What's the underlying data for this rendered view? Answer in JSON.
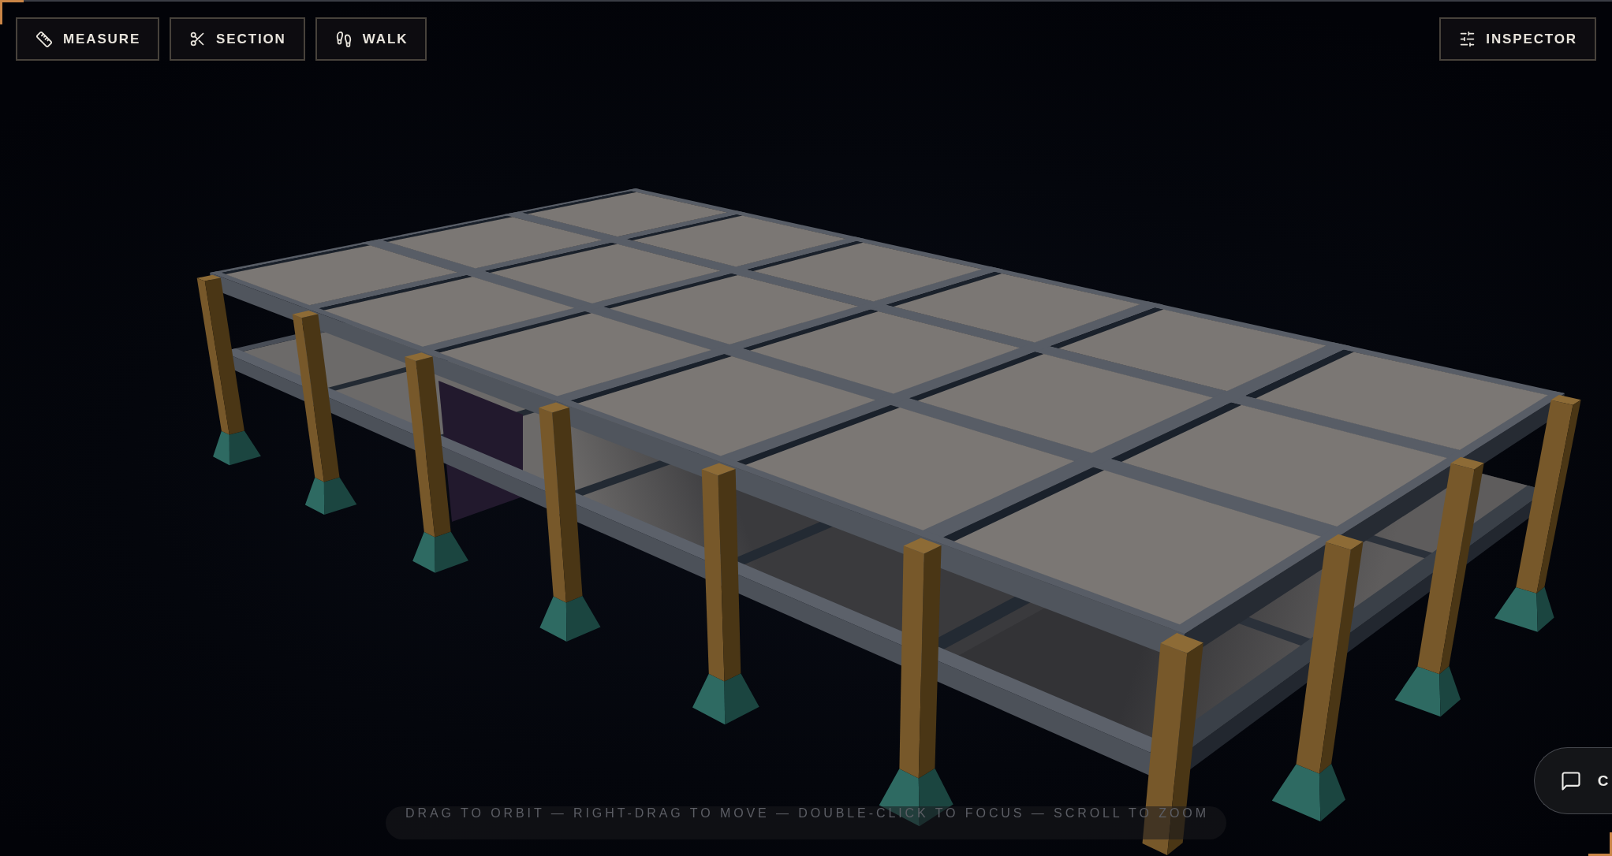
{
  "toolbar": {
    "tools": [
      {
        "kind": "measure",
        "label": "MEASURE"
      },
      {
        "kind": "section",
        "label": "SECTION"
      },
      {
        "kind": "walk",
        "label": "WALK"
      }
    ]
  },
  "inspector_button": {
    "label": "INSPECTOR"
  },
  "viewport": {
    "hint": "DRAG TO ORBIT — RIGHT-DRAG TO MOVE — DOUBLE-CLICK TO FOCUS — SCROLL TO ZOOM"
  },
  "chat_button": {
    "label": "C"
  }
}
